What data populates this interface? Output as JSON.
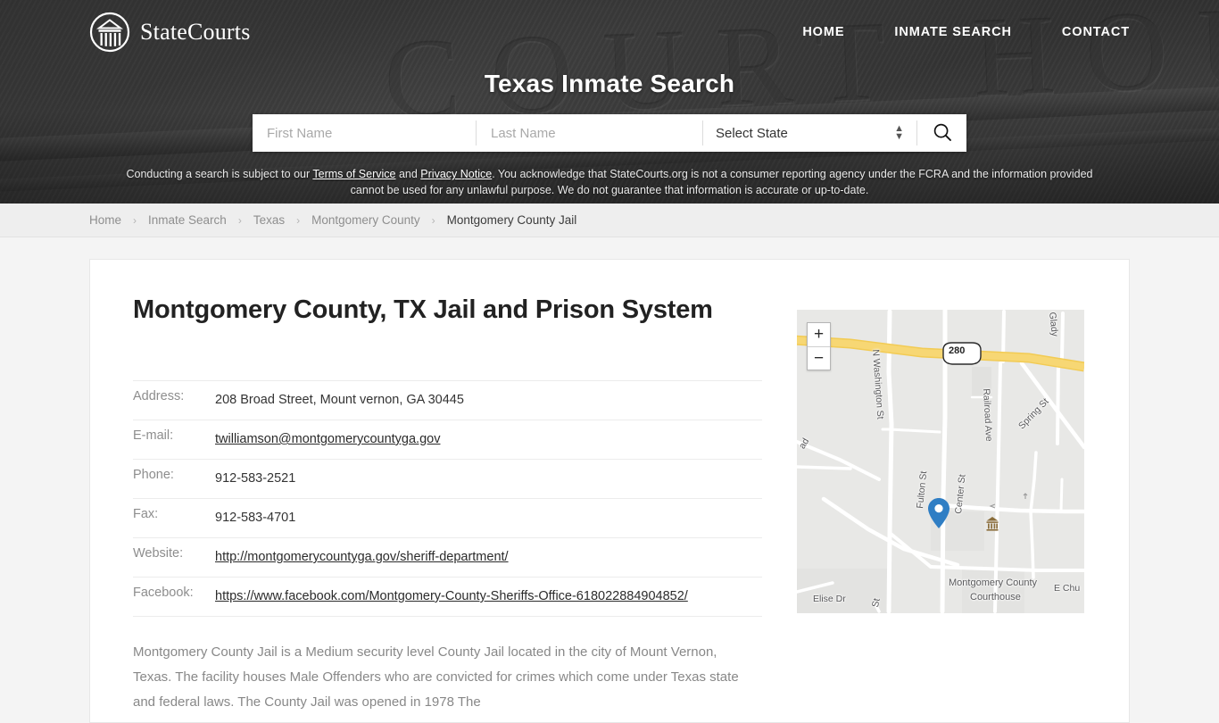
{
  "header": {
    "brand_name": "StateCourts",
    "logo_icon": "courthouse-circle-logo",
    "nav": [
      {
        "label": "HOME"
      },
      {
        "label": "INMATE SEARCH"
      },
      {
        "label": "CONTACT"
      }
    ],
    "hero_title": "Texas Inmate Search",
    "background_engraving": "COURT HOUSE"
  },
  "search": {
    "first_name_placeholder": "First Name",
    "first_name_value": "",
    "last_name_placeholder": "Last Name",
    "last_name_value": "",
    "state_selected": "Select State",
    "search_icon": "magnifier-icon"
  },
  "disclaimer": {
    "part1": "Conducting a search is subject to our ",
    "terms_link": "Terms of Service",
    "part2": " and ",
    "privacy_link": "Privacy Notice",
    "part3": ". You acknowledge that StateCourts.org is not a consumer reporting agency under the FCRA and the information provided cannot be used for any unlawful purpose. We do not guarantee that information is accurate or up-to-date."
  },
  "breadcrumb": {
    "items": [
      {
        "label": "Home"
      },
      {
        "label": "Inmate Search"
      },
      {
        "label": "Texas"
      },
      {
        "label": "Montgomery County"
      },
      {
        "label": "Montgomery County Jail"
      }
    ],
    "separator": "›"
  },
  "main": {
    "page_title": "Montgomery County, TX Jail and Prison System",
    "info_rows": [
      {
        "label": "Address:",
        "value": "208 Broad Street, Mount vernon, GA 30445",
        "link": false
      },
      {
        "label": "E-mail:",
        "value": "twilliamson@montgomerycountyga.gov",
        "link": true
      },
      {
        "label": "Phone:",
        "value": "912-583-2521",
        "link": false
      },
      {
        "label": "Fax:",
        "value": "912-583-4701",
        "link": false
      },
      {
        "label": "Website:",
        "value": "http://montgomerycountyga.gov/sheriff-department/",
        "link": true
      },
      {
        "label": "Facebook:",
        "value": "https://www.facebook.com/Montgomery-County-Sheriffs-Office-618022884904852/",
        "link": true
      }
    ],
    "description": "Montgomery County Jail is a Medium security level County Jail located in the city of Mount Vernon, Texas. The facility houses Male Offenders who are convicted for crimes which come under Texas state and federal laws. The County Jail was opened in 1978 The"
  },
  "map": {
    "zoom_in_label": "+",
    "zoom_out_label": "−",
    "marker_icon": "map-pin-marker",
    "highway_shield": "280",
    "poi": {
      "name_line1": "Montgomery County",
      "name_line2": "Courthouse",
      "icon": "courthouse-poi-icon"
    },
    "street_labels": [
      {
        "text": "N Washington St"
      },
      {
        "text": "Railroad Ave"
      },
      {
        "text": "Spring St"
      },
      {
        "text": "Glady"
      },
      {
        "text": "Fulton St"
      },
      {
        "text": "Center St"
      },
      {
        "text": "Elise Dr"
      },
      {
        "text": "E Chu"
      },
      {
        "text": "St"
      },
      {
        "text": "ad"
      }
    ],
    "colors": {
      "highway": "#f7d774",
      "marker": "#2f7ec4",
      "land": "#e8e8e6",
      "road": "#ffffff"
    }
  }
}
